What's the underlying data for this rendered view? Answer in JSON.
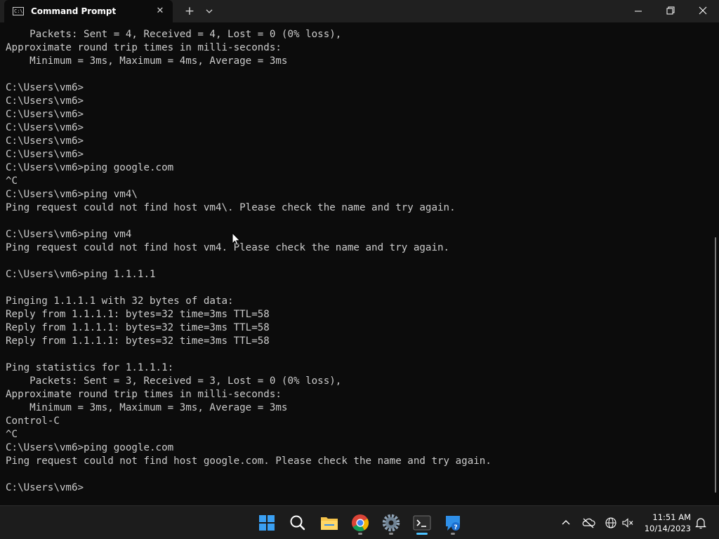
{
  "window": {
    "tab_title": "Command Prompt",
    "tab_icon_glyph": "C:\\",
    "new_tab_label": "+",
    "close_tab_label": "✕"
  },
  "terminal": {
    "lines": [
      "    Packets: Sent = 4, Received = 4, Lost = 0 (0% loss),",
      "Approximate round trip times in milli-seconds:",
      "    Minimum = 3ms, Maximum = 4ms, Average = 3ms",
      "",
      "C:\\Users\\vm6>",
      "C:\\Users\\vm6>",
      "C:\\Users\\vm6>",
      "C:\\Users\\vm6>",
      "C:\\Users\\vm6>",
      "C:\\Users\\vm6>",
      "C:\\Users\\vm6>ping google.com",
      "^C",
      "C:\\Users\\vm6>ping vm4\\",
      "Ping request could not find host vm4\\. Please check the name and try again.",
      "",
      "C:\\Users\\vm6>ping vm4",
      "Ping request could not find host vm4. Please check the name and try again.",
      "",
      "C:\\Users\\vm6>ping 1.1.1.1",
      "",
      "Pinging 1.1.1.1 with 32 bytes of data:",
      "Reply from 1.1.1.1: bytes=32 time=3ms TTL=58",
      "Reply from 1.1.1.1: bytes=32 time=3ms TTL=58",
      "Reply from 1.1.1.1: bytes=32 time=3ms TTL=58",
      "",
      "Ping statistics for 1.1.1.1:",
      "    Packets: Sent = 3, Received = 3, Lost = 0 (0% loss),",
      "Approximate round trip times in milli-seconds:",
      "    Minimum = 3ms, Maximum = 3ms, Average = 3ms",
      "Control-C",
      "^C",
      "C:\\Users\\vm6>ping google.com",
      "Ping request could not find host google.com. Please check the name and try again.",
      "",
      "C:\\Users\\vm6>"
    ]
  },
  "taskbar": {
    "items": [
      {
        "name": "start-button",
        "icon": "windows-logo-icon"
      },
      {
        "name": "search-button",
        "icon": "search-icon"
      },
      {
        "name": "file-explorer-button",
        "icon": "folder-icon"
      },
      {
        "name": "chrome-button",
        "icon": "chrome-icon"
      },
      {
        "name": "settings-button",
        "icon": "gear-icon"
      },
      {
        "name": "terminal-button",
        "icon": "terminal-icon"
      },
      {
        "name": "get-help-button",
        "icon": "help-icon"
      }
    ],
    "clock": {
      "time": "11:51 AM",
      "date": "10/14/2023"
    }
  },
  "colors": {
    "terminal_bg": "#0c0c0c",
    "terminal_text": "#cccccc",
    "titlebar_bg": "#202020",
    "taskbar_bg": "#1c1c1c",
    "accent": "#4cc2ff"
  }
}
